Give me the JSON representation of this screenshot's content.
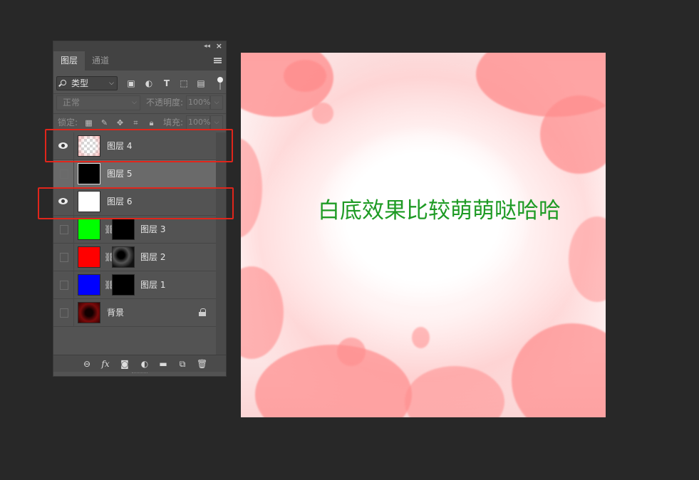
{
  "panel": {
    "tabs": [
      {
        "label": "图层",
        "active": true
      },
      {
        "label": "通道",
        "active": false
      }
    ],
    "filter": {
      "kind_label": "类型"
    },
    "blend": {
      "mode_label": "正常",
      "opacity_label": "不透明度:",
      "opacity_value": "100%"
    },
    "lock": {
      "label": "锁定:",
      "fill_label": "填充:",
      "fill_value": "100%"
    },
    "layers": [
      {
        "name": "图层 4",
        "visible": true,
        "thumb": "transparent-pink"
      },
      {
        "name": "图层 5",
        "visible": false,
        "thumb": "black",
        "selected": true
      },
      {
        "name": "图层 6",
        "visible": true,
        "thumb": "white"
      },
      {
        "name": "图层 3",
        "visible": false,
        "thumb": "#00ff00",
        "mask": "black"
      },
      {
        "name": "图层 2",
        "visible": false,
        "thumb": "#ff0000",
        "mask": "cloud"
      },
      {
        "name": "图层 1",
        "visible": false,
        "thumb": "#0000ff",
        "mask": "black"
      },
      {
        "name": "背景",
        "visible": false,
        "thumb": "dark-red",
        "locked": true
      }
    ],
    "footer_icons": [
      "link-icon",
      "fx-icon",
      "mask-icon",
      "adjustment-icon",
      "folder-icon",
      "new-layer-icon",
      "trash-icon"
    ]
  },
  "canvas": {
    "text": "白底效果比较萌萌哒哈哈",
    "text_color": "#1f9b25",
    "splash_color": "#ff8d8d"
  },
  "colors": {
    "highlight": "#e0251b",
    "panel_bg": "#535353",
    "app_bg": "#282828"
  }
}
